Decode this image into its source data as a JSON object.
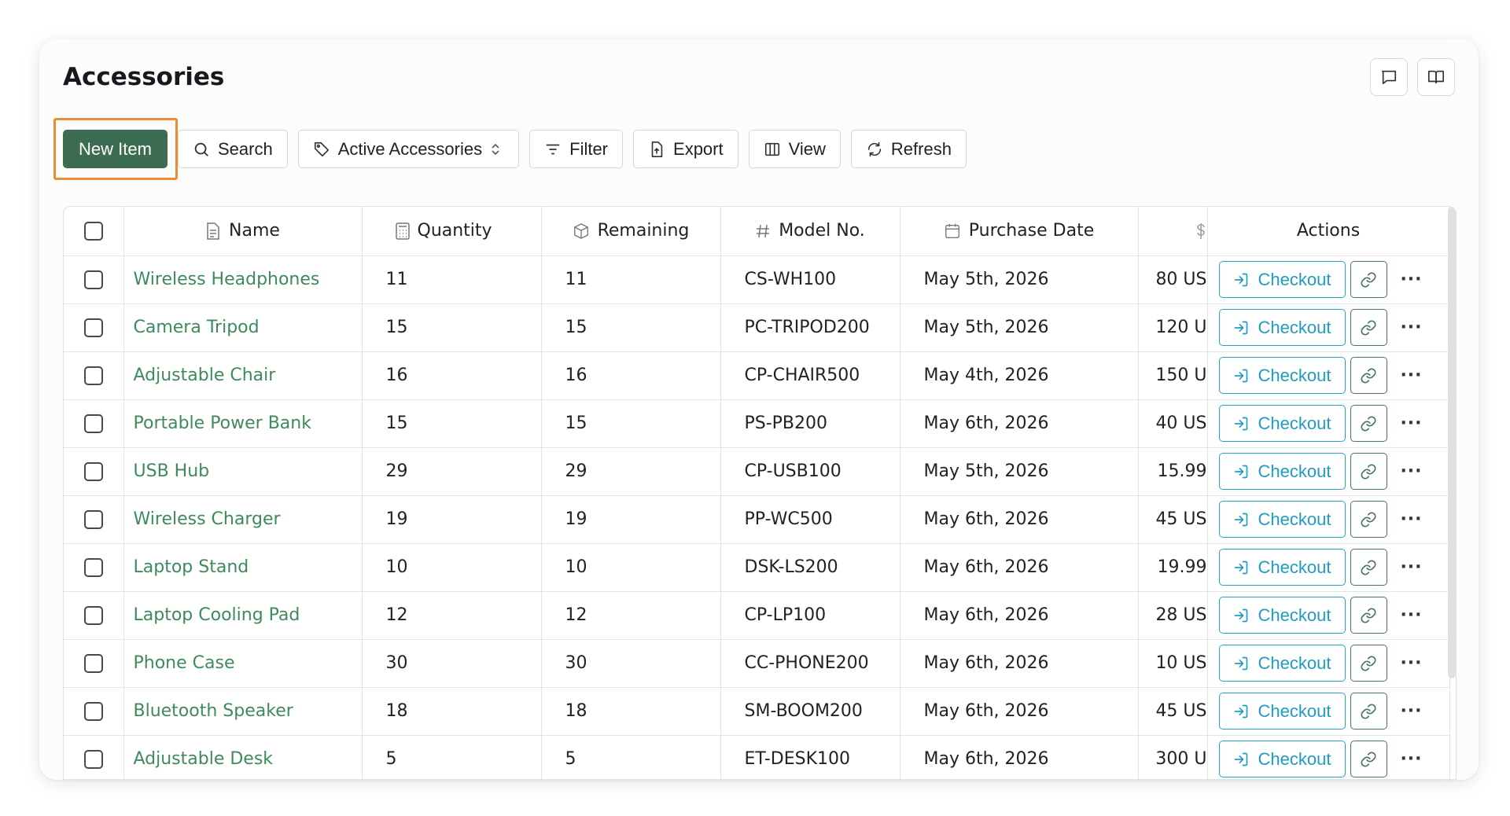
{
  "page": {
    "title": "Accessories"
  },
  "toolbar": {
    "new_item": "New Item",
    "search": "Search",
    "view_select": "Active Accessories",
    "filter": "Filter",
    "export": "Export",
    "view": "View",
    "refresh": "Refresh"
  },
  "table": {
    "columns": {
      "name": "Name",
      "quantity": "Quantity",
      "remaining": "Remaining",
      "model": "Model No.",
      "purchase_date": "Purchase Date",
      "actions": "Actions"
    },
    "checkout_label": "Checkout",
    "more_label": "···",
    "rows": [
      {
        "name": "Wireless Headphones",
        "quantity": "11",
        "remaining": "11",
        "model": "CS-WH100",
        "date": "May 5th, 2026",
        "price": "80 US"
      },
      {
        "name": "Camera Tripod",
        "quantity": "15",
        "remaining": "15",
        "model": "PC-TRIPOD200",
        "date": "May 5th, 2026",
        "price": "120 U"
      },
      {
        "name": "Adjustable Chair",
        "quantity": "16",
        "remaining": "16",
        "model": "CP-CHAIR500",
        "date": "May 4th, 2026",
        "price": "150 U"
      },
      {
        "name": "Portable Power Bank",
        "quantity": "15",
        "remaining": "15",
        "model": "PS-PB200",
        "date": "May 6th, 2026",
        "price": "40 US"
      },
      {
        "name": "USB Hub",
        "quantity": "29",
        "remaining": "29",
        "model": "CP-USB100",
        "date": "May 5th, 2026",
        "price": "15.99"
      },
      {
        "name": "Wireless Charger",
        "quantity": "19",
        "remaining": "19",
        "model": "PP-WC500",
        "date": "May 6th, 2026",
        "price": "45 US"
      },
      {
        "name": "Laptop Stand",
        "quantity": "10",
        "remaining": "10",
        "model": "DSK-LS200",
        "date": "May 6th, 2026",
        "price": "19.99"
      },
      {
        "name": "Laptop Cooling Pad",
        "quantity": "12",
        "remaining": "12",
        "model": "CP-LP100",
        "date": "May 6th, 2026",
        "price": "28 US"
      },
      {
        "name": "Phone Case",
        "quantity": "30",
        "remaining": "30",
        "model": "CC-PHONE200",
        "date": "May 6th, 2026",
        "price": "10 US"
      },
      {
        "name": "Bluetooth Speaker",
        "quantity": "18",
        "remaining": "18",
        "model": "SM-BOOM200",
        "date": "May 6th, 2026",
        "price": "45 US"
      },
      {
        "name": "Adjustable Desk",
        "quantity": "5",
        "remaining": "5",
        "model": "ET-DESK100",
        "date": "May 6th, 2026",
        "price": "300 U"
      }
    ]
  },
  "icons": {
    "comment": "message-square-icon",
    "docs": "book-open-icon",
    "search": "search-icon",
    "tag": "tag-icon",
    "filter": "filter-icon",
    "export": "file-export-icon",
    "view": "columns-icon",
    "refresh": "refresh-icon",
    "checkout": "sign-in-arrow-icon",
    "link": "link-icon",
    "more": "more-horizontal-icon"
  },
  "colors": {
    "primary": "#3c6d53",
    "link_text": "#3f8a5c",
    "checkout": "#1f9cc0",
    "highlight": "#ef8c33"
  }
}
